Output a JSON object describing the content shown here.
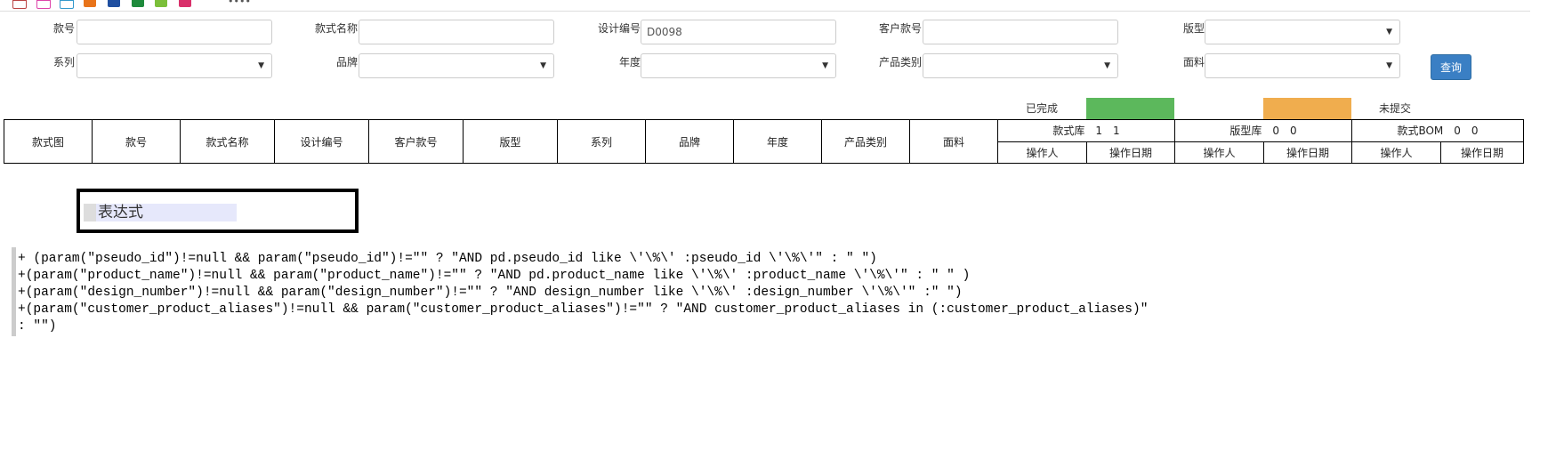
{
  "toolbar": {
    "icons": [
      {
        "name": "document-icon",
        "color": "#ffffff",
        "border": "#b44"
      },
      {
        "name": "new-document-icon",
        "color": "#ffffff",
        "border": "#d4a"
      },
      {
        "name": "copy-document-icon",
        "color": "#ffffff",
        "border": "#39c"
      },
      {
        "name": "edit-icon",
        "color": "#e8741a"
      },
      {
        "name": "word-icon",
        "color": "#1f4fa0"
      },
      {
        "name": "excel-icon",
        "color": "#1e8a3c"
      },
      {
        "name": "sheet-icon",
        "color": "#7bbf3a"
      },
      {
        "name": "picture-icon",
        "color": "#d9306b"
      }
    ],
    "trailing_text": "••••"
  },
  "search": {
    "style_no_label": "款号",
    "style_name_label": "款式名称",
    "design_no_label": "设计编号",
    "design_no_value": "D0098",
    "customer_no_label": "客户款号",
    "pattern_label": "版型",
    "series_label": "系列",
    "brand_label": "品牌",
    "year_label": "年度",
    "category_label": "产品类别",
    "fabric_label": "面料",
    "query_button": "查询",
    "caret": "▼"
  },
  "legend": {
    "done_label": "已完成",
    "done_color": "#5cb85c",
    "unsubmitted_label": "未提交",
    "unsubmitted_color": "#f0ad4e"
  },
  "table": {
    "headers": [
      "款式图",
      "款号",
      "款式名称",
      "设计编号",
      "客户款号",
      "版型",
      "系列",
      "品牌",
      "年度",
      "产品类别",
      "面料"
    ],
    "groups": [
      {
        "title": "款式库　1　1",
        "op_user": "操作人",
        "op_date": "操作日期"
      },
      {
        "title": "版型库　0　0",
        "op_user": "操作人",
        "op_date": "操作日期"
      },
      {
        "title": "款式BOM　0　0",
        "op_user": "操作人",
        "op_date": "操作日期"
      }
    ]
  },
  "expression": {
    "title": "表达式",
    "code_lines": [
      "+ (param(\"pseudo_id\")!=null && param(\"pseudo_id\")!=\"\" ? \"AND pd.pseudo_id like \\'\\%\\' :pseudo_id \\'\\%\\'\" : \" \")",
      "+(param(\"product_name\")!=null && param(\"product_name\")!=\"\" ? \"AND pd.product_name like \\'\\%\\' :product_name \\'\\%\\'\" : \" \" )",
      "+(param(\"design_number\")!=null && param(\"design_number\")!=\"\" ? \"AND design_number like \\'\\%\\' :design_number \\'\\%\\'\" :\" \")",
      "+(param(\"customer_product_aliases\")!=null && param(\"customer_product_aliases\")!=\"\" ? \"AND customer_product_aliases in (:customer_product_aliases)\"",
      ": \"\")"
    ]
  }
}
